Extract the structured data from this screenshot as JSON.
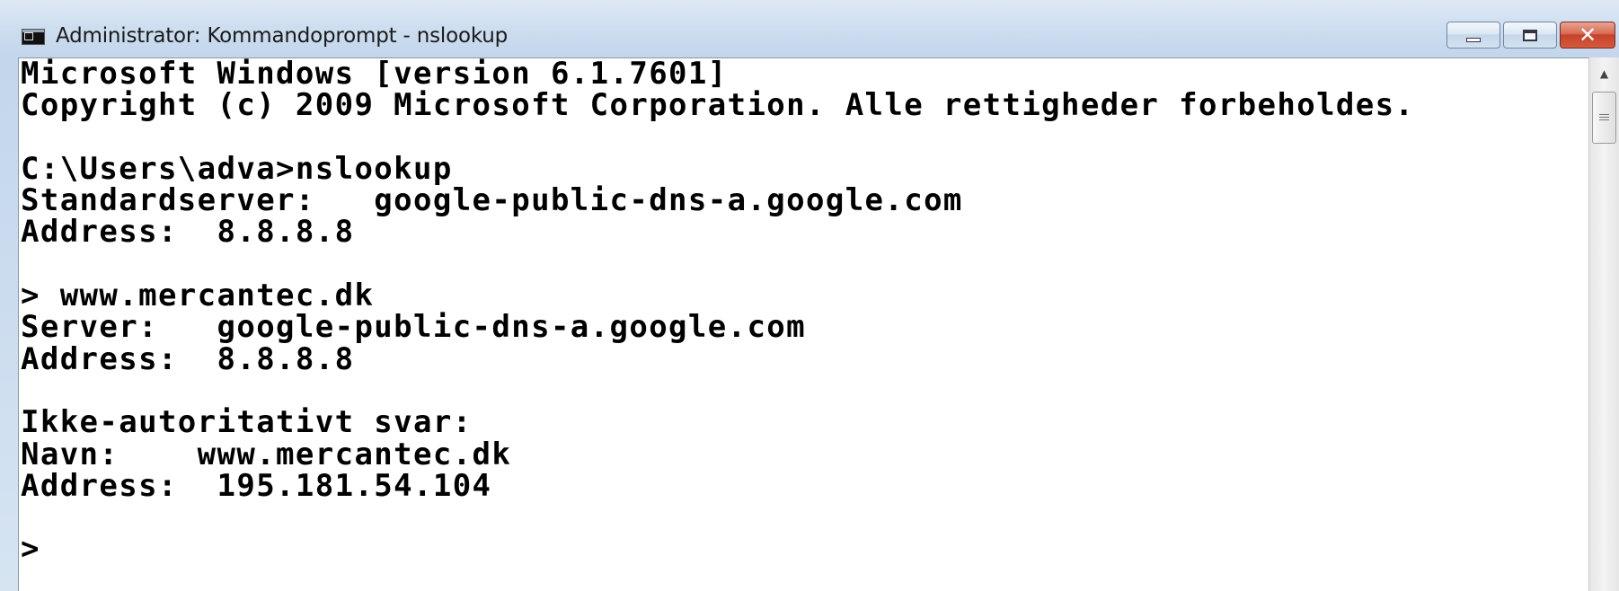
{
  "window": {
    "title": "Administrator: Kommandoprompt - nslookup",
    "icon": "cmd-icon",
    "controls": {
      "minimize": "minimize-icon",
      "maximize": "maximize-icon",
      "close": "close-icon",
      "close_glyph": "✕"
    }
  },
  "console": {
    "text": "Microsoft Windows [version 6.1.7601]\nCopyright (c) 2009 Microsoft Corporation. Alle rettigheder forbeholdes.\n\nC:\\Users\\adva>nslookup\nStandardserver:   google-public-dns-a.google.com\nAddress:  8.8.8.8\n\n> www.mercantec.dk\nServer:   google-public-dns-a.google.com\nAddress:  8.8.8.8\n\nIkke-autoritativt svar:\nNavn:    www.mercantec.dk\nAddress:  195.181.54.104\n\n>",
    "colors": {
      "background": "#ffffff",
      "foreground": "#000000"
    }
  },
  "scrollbar": {
    "up_arrow": "▲",
    "icons": [
      "scroll-up-icon",
      "scroll-thumb-grip-icon"
    ]
  }
}
